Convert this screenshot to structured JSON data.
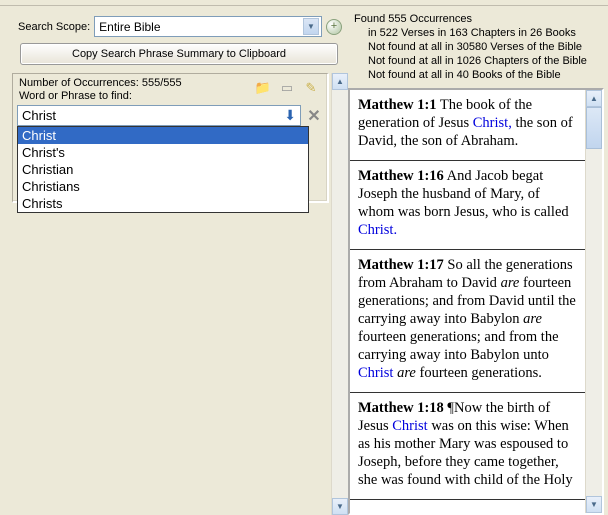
{
  "scope": {
    "label": "Search Scope:",
    "value": "Entire Bible"
  },
  "copy_button": "Copy Search Phrase Summary to Clipboard",
  "search_panel": {
    "occ_label": "Number of Occurrences: 555/555",
    "phrase_label": "Word or Phrase to find:",
    "input_value": "Christ",
    "dropdown": [
      "Christ",
      "Christ's",
      "Christian",
      "Christians",
      "Christs"
    ],
    "selected_index": 0
  },
  "stats": {
    "line1": "Found 555 Occurrences",
    "line2": "in 522 Verses in 163 Chapters in 26 Books",
    "line3": "Not found at all in 30580 Verses of the Bible",
    "line4": "Not found at all in 1026 Chapters of the Bible",
    "line5": "Not found at all in 40 Books of the Bible"
  },
  "results": [
    {
      "ref": "Matthew 1:1",
      "parts": [
        {
          "t": " The book of the generation of Jesus "
        },
        {
          "t": "Christ,",
          "hl": true
        },
        {
          "t": " the son of David, the son of Abraham."
        }
      ]
    },
    {
      "ref": "Matthew 1:16",
      "parts": [
        {
          "t": " And Jacob begat Joseph the husband of Mary, of whom was born Jesus, who is called "
        },
        {
          "t": "Christ.",
          "hl": true
        }
      ]
    },
    {
      "ref": "Matthew 1:17",
      "parts": [
        {
          "t": " So all the generations from Abraham to David "
        },
        {
          "t": "are",
          "ital": true
        },
        {
          "t": " fourteen generations; and from David until the carrying away into Babylon "
        },
        {
          "t": "are",
          "ital": true
        },
        {
          "t": " fourteen generations; and from the carrying away into Babylon unto "
        },
        {
          "t": "Christ",
          "hl": true
        },
        {
          "t": " "
        },
        {
          "t": "are",
          "ital": true
        },
        {
          "t": " fourteen generations."
        }
      ]
    },
    {
      "ref": "Matthew 1:18",
      "parts": [
        {
          "t": " ¶Now the birth of Jesus "
        },
        {
          "t": "Christ",
          "hl": true
        },
        {
          "t": " was on this wise: When as his mother Mary was espoused to Joseph, before they came together, she was found with child of the Holy"
        }
      ]
    }
  ]
}
